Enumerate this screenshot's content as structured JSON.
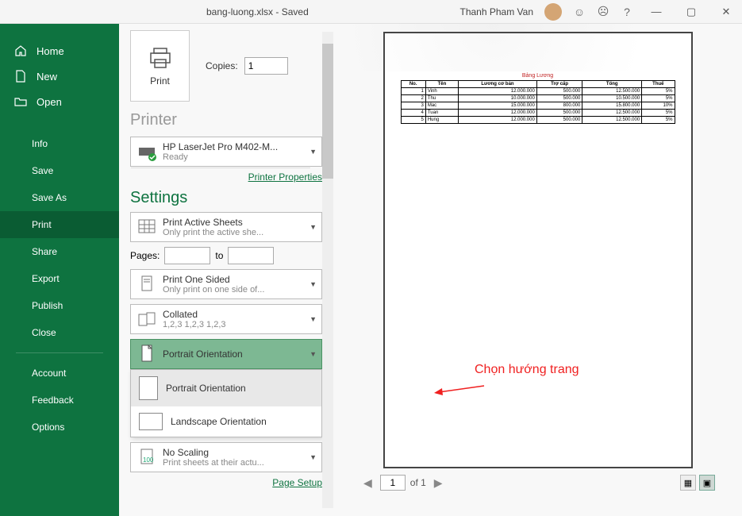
{
  "titlebar": {
    "filename": "bang-luong.xlsx - Saved",
    "user": "Thanh Pham Van"
  },
  "sidebar": {
    "home": "Home",
    "new": "New",
    "open": "Open",
    "info": "Info",
    "save": "Save",
    "saveas": "Save As",
    "print": "Print",
    "share": "Share",
    "export": "Export",
    "publish": "Publish",
    "close": "Close",
    "account": "Account",
    "feedback": "Feedback",
    "options": "Options"
  },
  "panel": {
    "print_label": "Print",
    "copies_label": "Copies:",
    "copies_value": "1",
    "printer_heading": "Printer",
    "printer_name": "HP LaserJet Pro M402-M...",
    "printer_status": "Ready",
    "printer_properties": "Printer Properties",
    "settings_heading": "Settings",
    "print_active_title": "Print Active Sheets",
    "print_active_sub": "Only print the active she...",
    "pages_label": "Pages:",
    "pages_to": "to",
    "one_sided_title": "Print One Sided",
    "one_sided_sub": "Only print on one side of...",
    "collated_title": "Collated",
    "collated_sub": "1,2,3    1,2,3    1,2,3",
    "orientation_title": "Portrait Orientation",
    "orient_portrait": "Portrait Orientation",
    "orient_landscape": "Landscape Orientation",
    "scaling_title": "No Scaling",
    "scaling_sub": "Print sheets at their actu...",
    "page_setup": "Page Setup"
  },
  "preview": {
    "title": "Bảng Lương",
    "headers": [
      "No.",
      "Tên",
      "Lương cơ bản",
      "Trợ cấp",
      "Tổng",
      "Thuế"
    ],
    "rows": [
      [
        "1",
        "Vinh",
        "12.000.000",
        "500.000",
        "12.500.000",
        "5%"
      ],
      [
        "2",
        "Thu",
        "10.000.000",
        "500.000",
        "10.500.000",
        "5%"
      ],
      [
        "3",
        "Mac",
        "15.000.000",
        "800.000",
        "15.800.000",
        "10%"
      ],
      [
        "4",
        "Tuan",
        "12.000.000",
        "500.000",
        "12.500.000",
        "5%"
      ],
      [
        "5",
        "Hung",
        "12.000.000",
        "500.000",
        "12.500.000",
        "5%"
      ]
    ],
    "page_current": "1",
    "page_of": "of 1"
  },
  "annotation": {
    "text": "Chọn hướng trang"
  }
}
